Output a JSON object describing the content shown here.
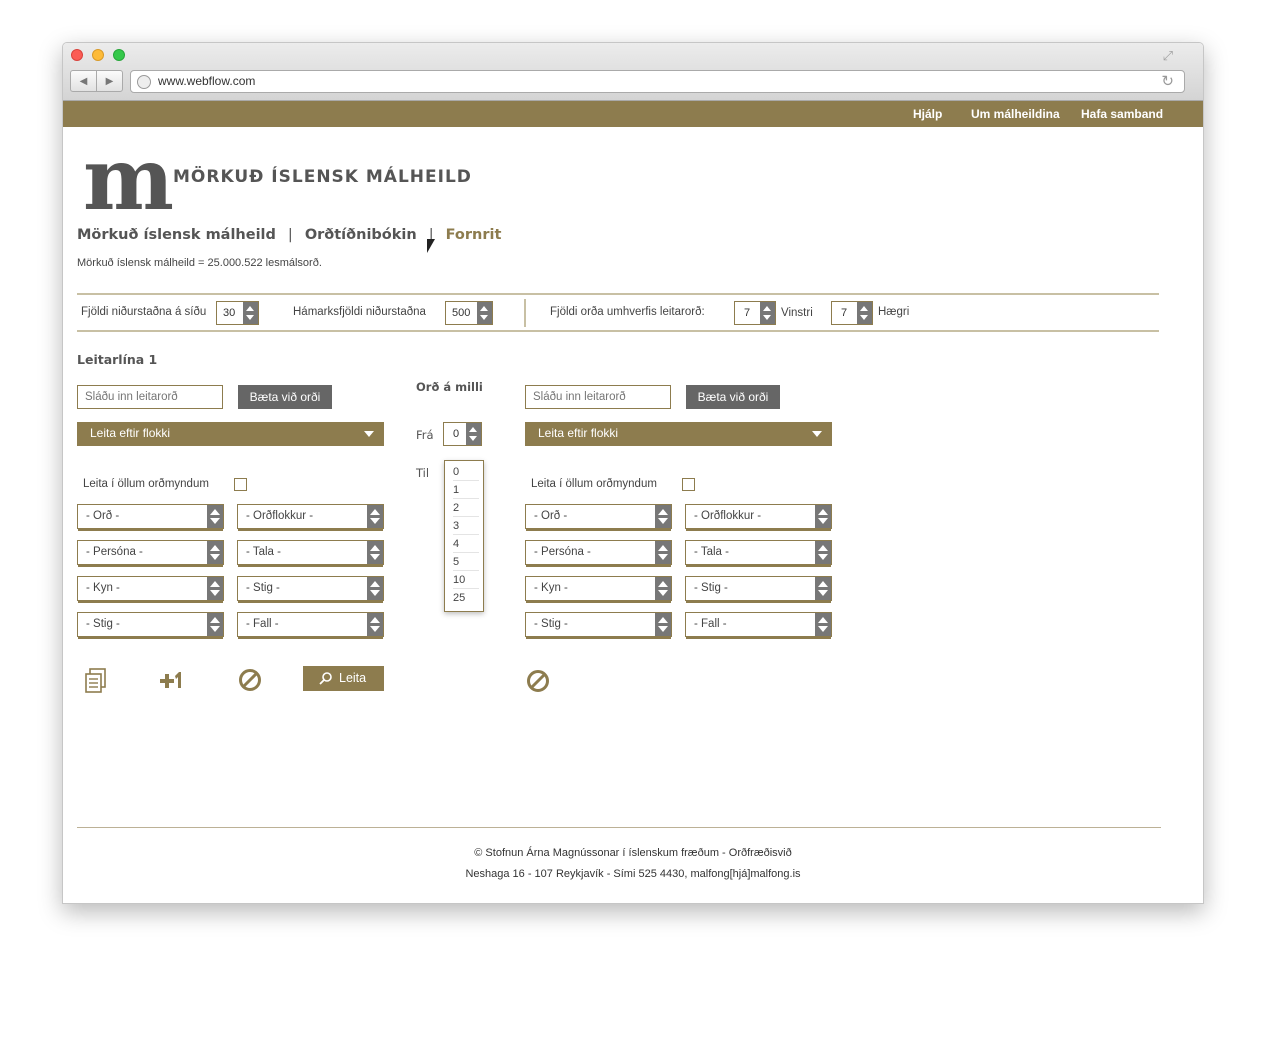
{
  "browser": {
    "url": "www.webflow.com"
  },
  "topnav": {
    "links": [
      "Hjálp",
      "Um málheildina",
      "Hafa samband"
    ]
  },
  "brand": {
    "glyph": "m",
    "name": "MÖRKUÐ ÍSLENSK MÁLHEILD"
  },
  "breadcrumbs": {
    "items": [
      "Mörkuð íslensk málheild",
      "Orðtíðnibókin",
      "Fornrit"
    ],
    "separator": "|",
    "active_index": 2
  },
  "info": {
    "word_count": "Mörkuð íslensk málheild = 25.000.522 lesmálsorð."
  },
  "options": {
    "results_per_page_label": "Fjöldi niðurstaðna á síðu",
    "results_per_page_value": "30",
    "max_results_label": "Hámarksfjöldi niðurstaðna",
    "max_results_value": "500",
    "context_words_label": "Fjöldi orða umhverfis leitarorð:",
    "left_value": "7",
    "left_label": "Vinstri",
    "right_value": "7",
    "right_label": "Hægri"
  },
  "search_line": {
    "title": "Leitarlína 1",
    "input_placeholder": "Sláðu inn leitarorð",
    "add_word_label": "Bæta við orði",
    "category_select_label": "Leita eftir flokki",
    "all_forms_label": "Leita í öllum orðmyndum",
    "selects": [
      "- Orð -",
      "- Orðflokkur -",
      "- Persóna -",
      "- Tala -",
      "- Kyn -",
      "- Stig -",
      "- Stig  -",
      "- Fall -"
    ],
    "search_button_label": "Leita"
  },
  "between": {
    "title": "Orð á milli",
    "from_label": "Frá",
    "from_value": "0",
    "to_label": "Til",
    "options": [
      "0",
      "1",
      "2",
      "3",
      "4",
      "5",
      "10",
      "25"
    ]
  },
  "footer": {
    "line1": "© Stofnun Árna Magnússonar í íslenskum fræðum - Orðfræðisvið",
    "line2": "Neshaga 16 - 107 Reykjavík - Sími 525 4430, malfong[hjá]malfong.is"
  },
  "icons": {
    "copy": "copy-icon",
    "add_line": "plus-one-icon",
    "clear": "cancel-icon",
    "search": "magnifier-icon"
  },
  "colors": {
    "accent": "#8d7c4e",
    "button_dark": "#666666",
    "text": "#555555"
  }
}
